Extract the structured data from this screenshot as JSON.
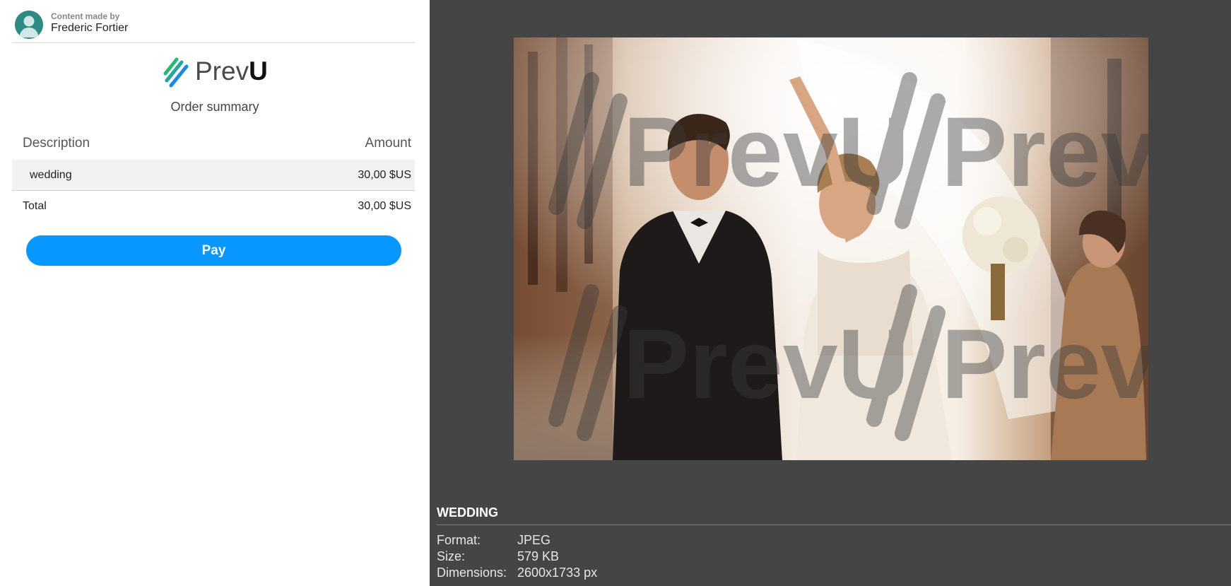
{
  "author": {
    "caption": "Content made by",
    "name": "Frederic Fortier"
  },
  "brand": {
    "name_regular": "Prev",
    "name_bold": "U",
    "accent_colors": [
      "#2bb673",
      "#1e88e5"
    ]
  },
  "order": {
    "title": "Order summary",
    "columns": {
      "description": "Description",
      "amount": "Amount"
    },
    "items": [
      {
        "description": "wedding",
        "amount": "30,00 $US"
      }
    ],
    "total": {
      "label": "Total",
      "amount": "30,00 $US"
    },
    "pay_label": "Pay",
    "pay_color": "#0797ff"
  },
  "preview": {
    "watermark_text": "PrevU",
    "file_title": "WEDDING",
    "meta": [
      {
        "key": "Format:",
        "value": "JPEG"
      },
      {
        "key": "Size:",
        "value": "579 KB"
      },
      {
        "key": "Dimensions:",
        "value": "2600x1733 px"
      }
    ]
  }
}
